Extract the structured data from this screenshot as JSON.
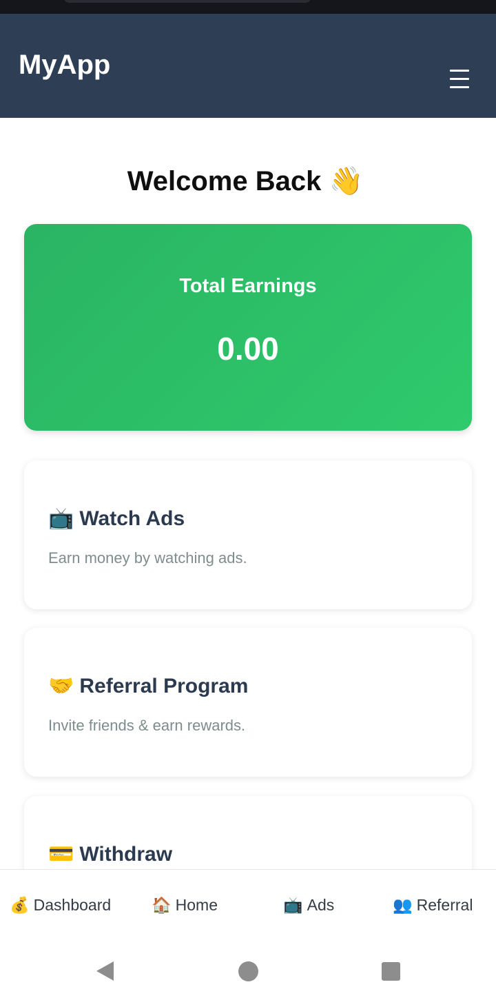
{
  "header": {
    "title": "MyApp",
    "menu_icon": "hamburger-menu-icon"
  },
  "welcome": {
    "text": "Welcome Back",
    "emoji": "👋"
  },
  "earnings": {
    "label": "Total Earnings",
    "value": "0.00",
    "card_color": "#2ecc71"
  },
  "features": [
    {
      "icon": "📺",
      "title": "Watch Ads",
      "description": "Earn money by watching ads."
    },
    {
      "icon": "🤝",
      "title": "Referral Program",
      "description": "Invite friends & earn rewards."
    },
    {
      "icon": "💳",
      "title": "Withdraw",
      "description": ""
    }
  ],
  "bottom_nav": [
    {
      "icon": "💰",
      "label": "Dashboard"
    },
    {
      "icon": "🏠",
      "label": "Home"
    },
    {
      "icon": "📺",
      "label": "Ads"
    },
    {
      "icon": "👥",
      "label": "Referral"
    }
  ],
  "colors": {
    "header_bg": "#2e3e54",
    "accent_green": "#2ecc71",
    "title_text": "#2b3a4f",
    "muted_text": "#7f8c8d"
  }
}
